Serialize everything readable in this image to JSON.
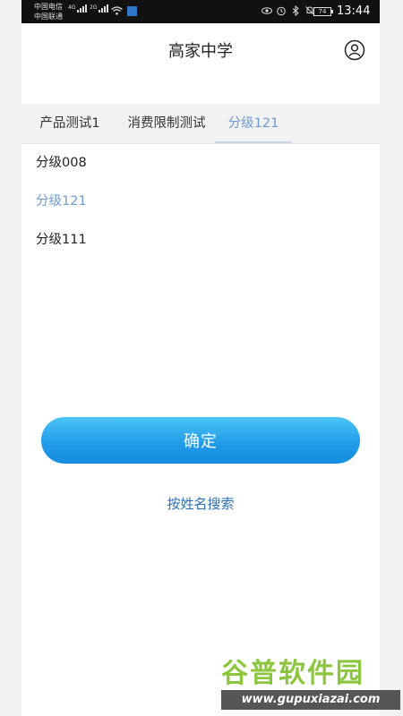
{
  "status_bar": {
    "carrier_1": "中国电信",
    "carrier_2": "中国联通",
    "net_1": "4G",
    "net_2": "2G",
    "battery": "74",
    "time": "13:44"
  },
  "header": {
    "title": "高家中学",
    "profile_icon": "user-circle-icon"
  },
  "tabs": [
    {
      "label": "产品测试1",
      "active": false
    },
    {
      "label": "消费限制测试",
      "active": false
    },
    {
      "label": "分级121",
      "active": true
    }
  ],
  "list": [
    {
      "label": "分级008",
      "selected": false
    },
    {
      "label": "分级121",
      "selected": true
    },
    {
      "label": "分级111",
      "selected": false
    }
  ],
  "actions": {
    "confirm_label": "确定",
    "search_by_name_label": "按姓名搜索"
  },
  "watermark": {
    "title": "谷普软件园",
    "url": "www.gupuxiazai.com"
  },
  "colors": {
    "accent": "#6e9bd1",
    "button": "#1f9ae8",
    "link": "#2d6fb3",
    "tab_bg": "#f2f2f4"
  }
}
